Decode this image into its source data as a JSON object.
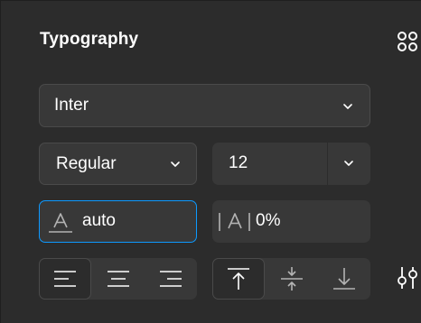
{
  "section": {
    "title": "Typography"
  },
  "font": {
    "family": "Inter",
    "style": "Regular",
    "size": "12"
  },
  "line_height": {
    "value": "auto"
  },
  "letter_spacing": {
    "value": "0%"
  },
  "text_align": {
    "options": [
      "left",
      "center",
      "right"
    ],
    "selected": "left"
  },
  "vertical_align": {
    "options": [
      "top",
      "middle",
      "bottom"
    ],
    "selected": "top"
  },
  "colors": {
    "panel_bg": "#2c2c2c",
    "field_bg": "#383838",
    "focus": "#0d99ff",
    "text": "#ffffff",
    "muted": "#b3b3b3"
  }
}
